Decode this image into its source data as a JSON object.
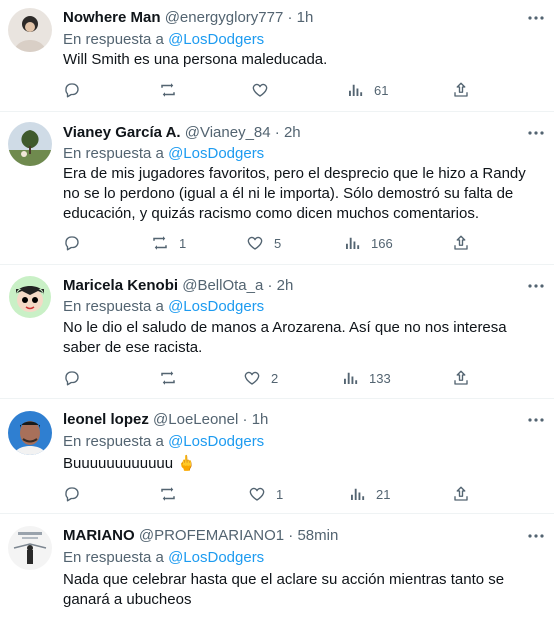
{
  "reply_prefix": "En respuesta a",
  "tweets": [
    {
      "name": "Nowhere Man",
      "handle": "@energyglory777",
      "time": "1h",
      "reply_to": "@LosDodgers",
      "text": "Will Smith es una persona maleducada.",
      "retweets": "",
      "likes": "",
      "views": "61"
    },
    {
      "name": "Vianey García A.",
      "handle": "@Vianey_84",
      "time": "2h",
      "reply_to": "@LosDodgers",
      "text": "Era de mis jugadores favoritos, pero el desprecio que le hizo a Randy no se lo perdono (igual a él ni le importa). Sólo demostró su falta de educación, y quizás racismo como dicen muchos comentarios.",
      "retweets": "1",
      "likes": "5",
      "views": "166"
    },
    {
      "name": "Maricela Kenobi",
      "handle": "@BellOta_a",
      "time": "2h",
      "reply_to": "@LosDodgers",
      "text": "No le dio el saludo de manos a Arozarena. Así que no nos interesa saber de ese racista.",
      "retweets": "",
      "likes": "2",
      "views": "133"
    },
    {
      "name": "leonel lopez",
      "handle": "@LoeLeonel",
      "time": "1h",
      "reply_to": "@LosDodgers",
      "text": "Buuuuuuuuuuuu 🖕",
      "retweets": "",
      "likes": "1",
      "views": "21"
    },
    {
      "name": "MARIANO",
      "handle": "@PROFEMARIANO1",
      "time": "58min",
      "reply_to": "@LosDodgers",
      "text": "Nada que celebrar hasta que el aclare su acción mientras tanto se ganará a ubucheos",
      "retweets": "",
      "likes": "",
      "views": ""
    }
  ],
  "icons": {
    "reply": "reply-icon",
    "retweet": "retweet-icon",
    "like": "heart-icon",
    "views": "views-icon",
    "share": "share-icon",
    "more": "more-icon"
  },
  "colors": {
    "link": "#1d9bf0",
    "muted": "#536471",
    "text": "#0f1419"
  }
}
